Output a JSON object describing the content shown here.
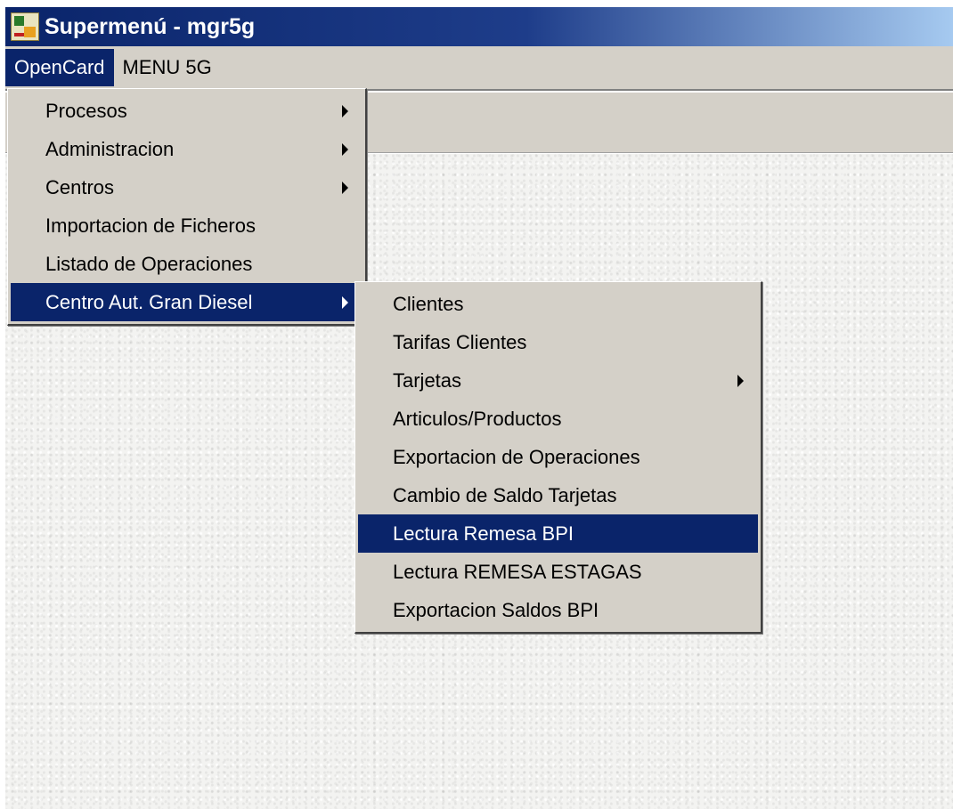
{
  "window": {
    "title": "Supermenú - mgr5g"
  },
  "menubar": {
    "items": [
      {
        "label": "OpenCard"
      },
      {
        "label": "MENU 5G"
      }
    ]
  },
  "opencard_menu": {
    "items": [
      {
        "label": "Procesos",
        "submenu": true
      },
      {
        "label": "Administracion",
        "submenu": true
      },
      {
        "label": "Centros",
        "submenu": true
      },
      {
        "label": "Importacion de Ficheros",
        "submenu": false
      },
      {
        "label": "Listado de Operaciones",
        "submenu": false
      },
      {
        "label": "Centro Aut. Gran Diesel",
        "submenu": true
      }
    ]
  },
  "centro_submenu": {
    "items": [
      {
        "label": "Clientes",
        "submenu": false
      },
      {
        "label": "Tarifas Clientes",
        "submenu": false
      },
      {
        "label": "Tarjetas",
        "submenu": true
      },
      {
        "label": "Articulos/Productos",
        "submenu": false
      },
      {
        "label": "Exportacion de Operaciones",
        "submenu": false
      },
      {
        "label": "Cambio de Saldo Tarjetas",
        "submenu": false
      },
      {
        "label": "Lectura Remesa BPI",
        "submenu": false
      },
      {
        "label": "Lectura REMESA ESTAGAS",
        "submenu": false
      },
      {
        "label": "Exportacion Saldos BPI",
        "submenu": false
      }
    ]
  },
  "colors": {
    "selection": "#0a246a",
    "menu_face": "#d4d0c8"
  },
  "icons": {
    "app": "app-icon",
    "submenu": "submenu-arrow-icon"
  }
}
